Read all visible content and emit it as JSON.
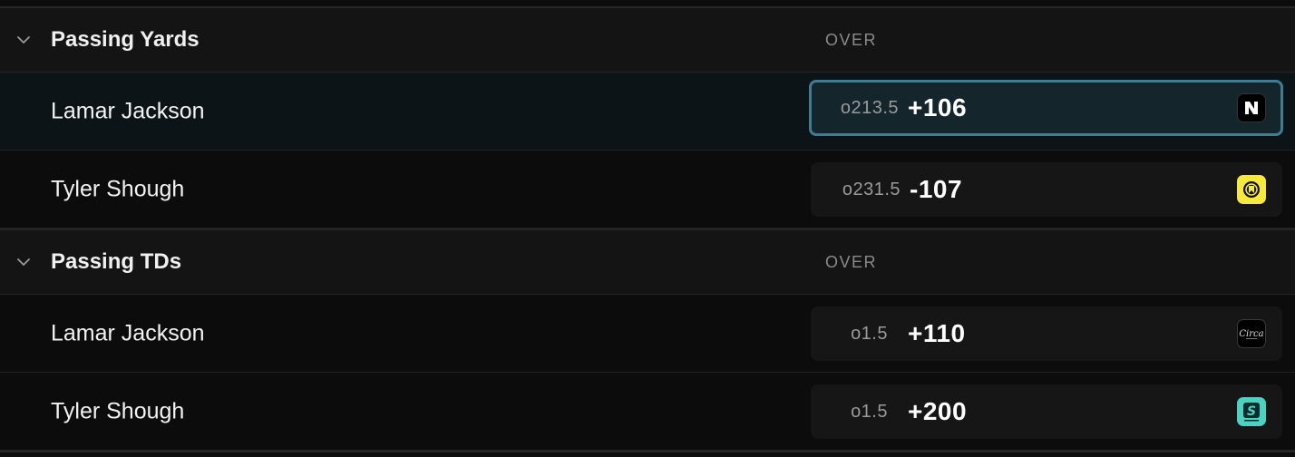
{
  "sections": [
    {
      "title": "Passing Yards",
      "column_label": "OVER",
      "rows": [
        {
          "player": "Lamar Jackson",
          "line": "o213.5",
          "price": "+106",
          "book_icon": "novig-logo-icon",
          "selected": true
        },
        {
          "player": "Tyler Shough",
          "line": "o231.5",
          "price": "-107",
          "book_icon": "rebet-logo-icon",
          "selected": false
        }
      ]
    },
    {
      "title": "Passing TDs",
      "column_label": "OVER",
      "rows": [
        {
          "player": "Lamar Jackson",
          "line": "o1.5",
          "price": "+110",
          "book_icon": "circa-logo-icon",
          "selected": false
        },
        {
          "player": "Tyler Shough",
          "line": "o1.5",
          "price": "+200",
          "book_icon": "sportsbook-s-logo-icon",
          "selected": false
        }
      ]
    }
  ],
  "colors": {
    "background": "#0c0c0c",
    "header_bg": "#141414",
    "selected_border": "#3e7e95",
    "selected_bg": "#14252c"
  }
}
